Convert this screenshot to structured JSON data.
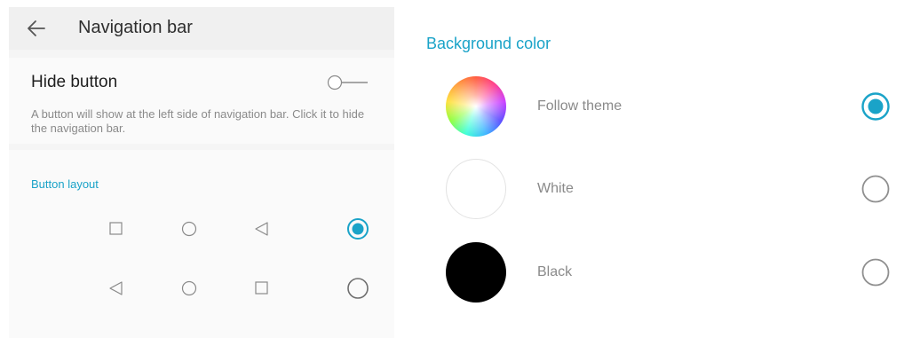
{
  "header": {
    "title": "Navigation bar"
  },
  "hide_button": {
    "title": "Hide button",
    "description": "A button will show at the left side of navigation bar. Click it to hide the navigation bar.",
    "enabled": false
  },
  "button_layout": {
    "label": "Button layout",
    "options": [
      {
        "icons": [
          "square-icon",
          "circle-icon",
          "triangle-left-icon"
        ],
        "selected": true
      },
      {
        "icons": [
          "triangle-left-icon",
          "circle-icon",
          "square-icon"
        ],
        "selected": false
      }
    ]
  },
  "background_color": {
    "label": "Background color",
    "options": [
      {
        "label": "Follow theme",
        "swatch": "gradient",
        "selected": true
      },
      {
        "label": "White",
        "swatch": "#ffffff",
        "selected": false
      },
      {
        "label": "Black",
        "swatch": "#000000",
        "selected": false
      }
    ]
  },
  "colors": {
    "accent": "#1aa3c8",
    "radio_off": "#9e9e9e"
  }
}
